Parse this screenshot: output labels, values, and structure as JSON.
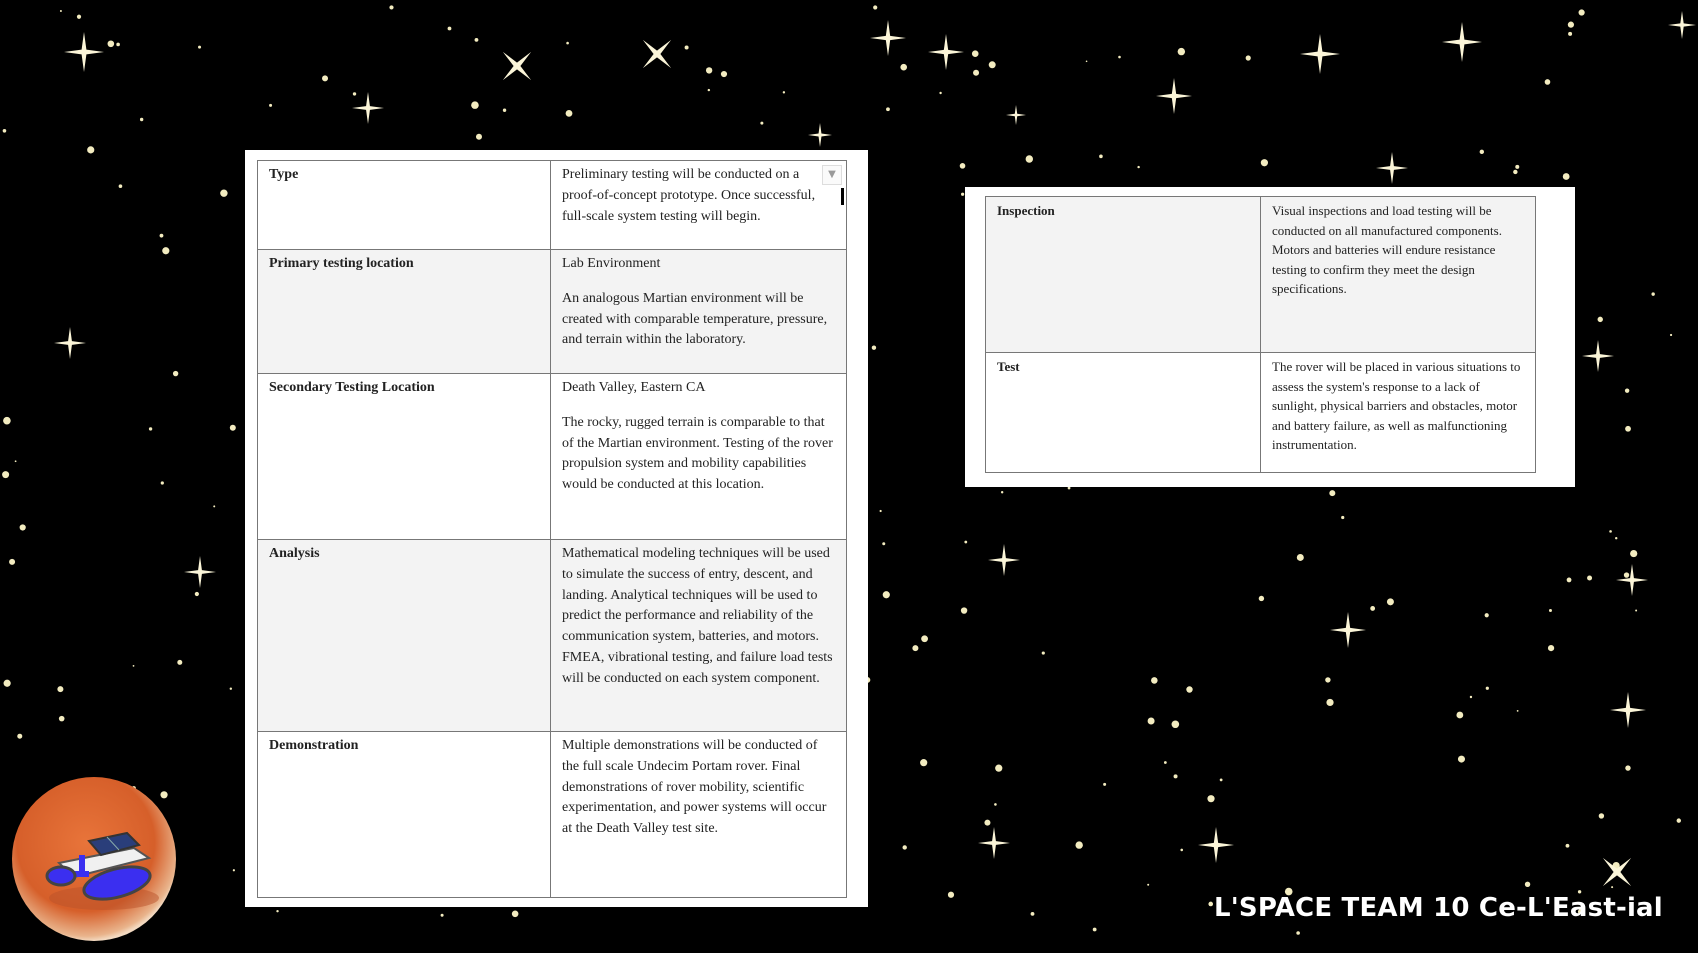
{
  "colors": {
    "background": "#000000",
    "star": "#f3ecc0",
    "card": "#ffffff",
    "shaded_row": "#f3f3f3",
    "rover_blue": "#3b2ff0",
    "mars": "#d9652e"
  },
  "left_table": {
    "rows": [
      {
        "label": "Type",
        "paragraphs": [
          "Preliminary testing will be conducted on a proof-of-concept prototype. Once successful, full-scale system testing will begin."
        ],
        "shaded": false
      },
      {
        "label": "Primary testing location",
        "paragraphs": [
          "Lab Environment",
          "An analogous Martian environment will be created with comparable temperature, pressure, and terrain within the laboratory."
        ],
        "shaded": true
      },
      {
        "label": "Secondary Testing Location",
        "paragraphs": [
          "Death Valley, Eastern CA",
          "The rocky, rugged terrain is comparable to that of the Martian environment. Testing of the rover propulsion system and mobility capabilities would be conducted at this location."
        ],
        "shaded": false
      },
      {
        "label": "Analysis",
        "paragraphs": [
          "Mathematical modeling techniques will be used to simulate the success of entry, descent, and landing. Analytical techniques will be used to predict the performance and reliability of the communication system, batteries, and motors. FMEA, vibrational testing, and failure load tests will be conducted on each system component."
        ],
        "shaded": true
      },
      {
        "label": "Demonstration",
        "paragraphs": [
          "Multiple demonstrations will be conducted of the full scale Undecim Portam rover. Final demonstrations of rover mobility, scientific experimentation, and power systems will occur at the Death Valley test site."
        ],
        "shaded": false
      }
    ]
  },
  "right_table": {
    "rows": [
      {
        "label": "Inspection",
        "paragraphs": [
          "Visual inspections and load testing will be conducted on all manufactured components. Motors and batteries will endure resistance testing to confirm they meet the design specifications."
        ],
        "shaded": true
      },
      {
        "label": "Test",
        "paragraphs": [
          "The rover will be placed in various situations to assess the system's response to a lack of sunlight, physical barriers and obstacles, motor and battery failure, as well as malfunctioning instrumentation."
        ],
        "shaded": false
      }
    ]
  },
  "footer": {
    "team_name": "L'SPACE TEAM 10 Ce-L'East-ial"
  },
  "logo": {
    "icon": "mars-rover-logo"
  },
  "icons": {
    "dropdown": "chevron-down-icon"
  }
}
